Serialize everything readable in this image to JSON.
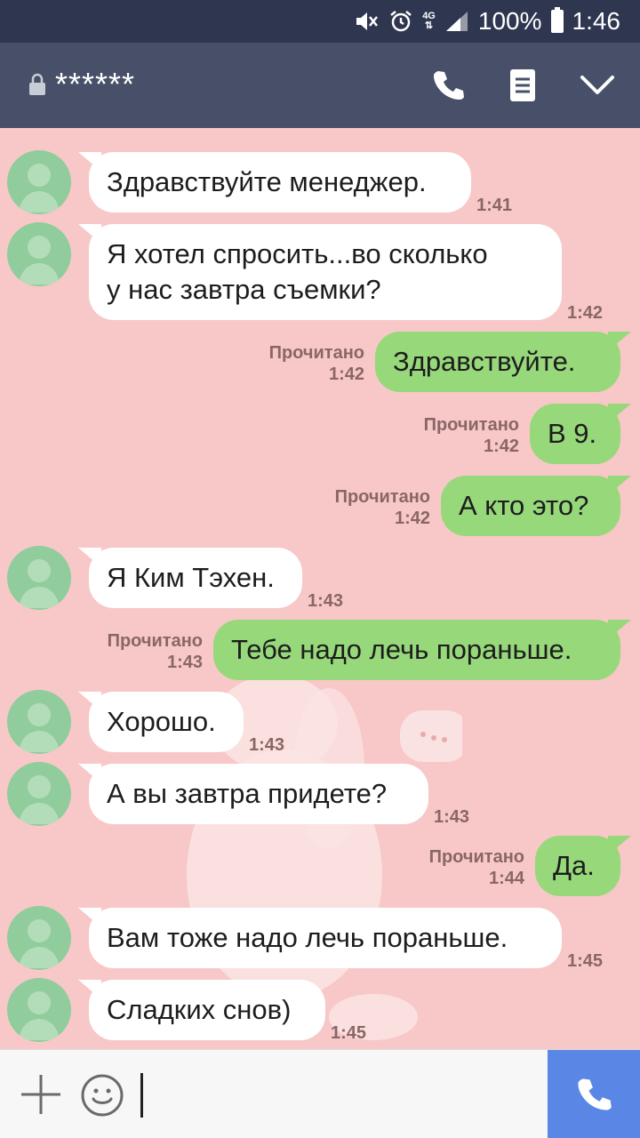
{
  "status_bar": {
    "battery": "100%",
    "time": "1:46",
    "network": "4G"
  },
  "header": {
    "title": "******"
  },
  "messages": [
    {
      "dir": "in",
      "text": "Здравствуйте менеджер.",
      "time": "1:41"
    },
    {
      "dir": "in",
      "text": "Я хотел спросить...во сколько\nу нас завтра съемки?",
      "time": "1:42"
    },
    {
      "dir": "out",
      "text": "Здравствуйте.",
      "read": "Прочитано",
      "time": "1:42"
    },
    {
      "dir": "out",
      "text": "В 9.",
      "read": "Прочитано",
      "time": "1:42"
    },
    {
      "dir": "out",
      "text": "А кто это?",
      "read": "Прочитано",
      "time": "1:42"
    },
    {
      "dir": "in",
      "text": "Я Ким Тэхен.",
      "time": "1:43"
    },
    {
      "dir": "out",
      "text": "Тебе надо лечь пораньше.",
      "read": "Прочитано",
      "time": "1:43"
    },
    {
      "dir": "in",
      "text": "Хорошо.",
      "time": "1:43"
    },
    {
      "dir": "in",
      "text": "А вы завтра придете?",
      "time": "1:43"
    },
    {
      "dir": "out",
      "text": "Да.",
      "read": "Прочитано",
      "time": "1:44"
    },
    {
      "dir": "in",
      "text": "Вам тоже надо лечь пораньше.",
      "time": "1:45"
    },
    {
      "dir": "in",
      "text": "Сладких снов)",
      "time": "1:45"
    }
  ],
  "colors": {
    "background": "#f8c8c8",
    "status_bar": "#2e3650",
    "header": "#475068",
    "bubble_out": "#97d87b",
    "bubble_in": "#ffffff",
    "call_button": "#5a86e6"
  }
}
